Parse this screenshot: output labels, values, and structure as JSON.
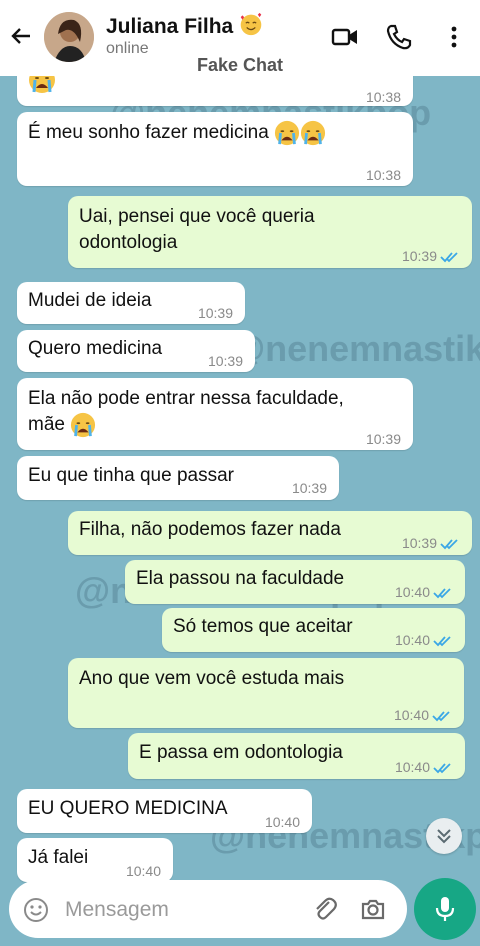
{
  "header": {
    "contact_name": "Juliana Filha",
    "status": "online",
    "app_label": "Fake Chat"
  },
  "watermark": "@nenemnastikpop",
  "messages": [
    {
      "dir": "in",
      "text": "",
      "time": "10:38",
      "emoji": "cry"
    },
    {
      "dir": "in",
      "text": "É meu sonho fazer medicina",
      "time": "10:38",
      "emoji": "cry2"
    },
    {
      "dir": "out",
      "text": "Uai, pensei que você queria",
      "text2": "odontologia",
      "time": "10:39"
    },
    {
      "dir": "in",
      "text": "Mudei de ideia",
      "time": "10:39"
    },
    {
      "dir": "in",
      "text": "Quero medicina",
      "time": "10:39"
    },
    {
      "dir": "in",
      "text": "Ela não pode entrar nessa faculdade,",
      "text2": "mãe",
      "time": "10:39",
      "emoji": "cry"
    },
    {
      "dir": "in",
      "text": "Eu que tinha que passar",
      "time": "10:39"
    },
    {
      "dir": "out",
      "text": "Filha, não podemos fazer nada",
      "time": "10:39"
    },
    {
      "dir": "out",
      "text": "Ela passou na faculdade",
      "time": "10:40"
    },
    {
      "dir": "out",
      "text": "Só temos que aceitar",
      "time": "10:40"
    },
    {
      "dir": "out",
      "text": "Ano que vem você estuda mais",
      "time": "10:40"
    },
    {
      "dir": "out",
      "text": "E passa em odontologia",
      "time": "10:40"
    },
    {
      "dir": "in",
      "text": "EU QUERO MEDICINA",
      "time": "10:40"
    },
    {
      "dir": "in",
      "text": "Já falei",
      "time": "10:40"
    }
  ],
  "composer": {
    "placeholder": "Mensagem"
  },
  "colors": {
    "chat_bg": "#7fb6c6",
    "outgoing": "#e7fbd3",
    "incoming": "#ffffff",
    "mic": "#17a785",
    "read_ticks": "#3ba7e6"
  }
}
